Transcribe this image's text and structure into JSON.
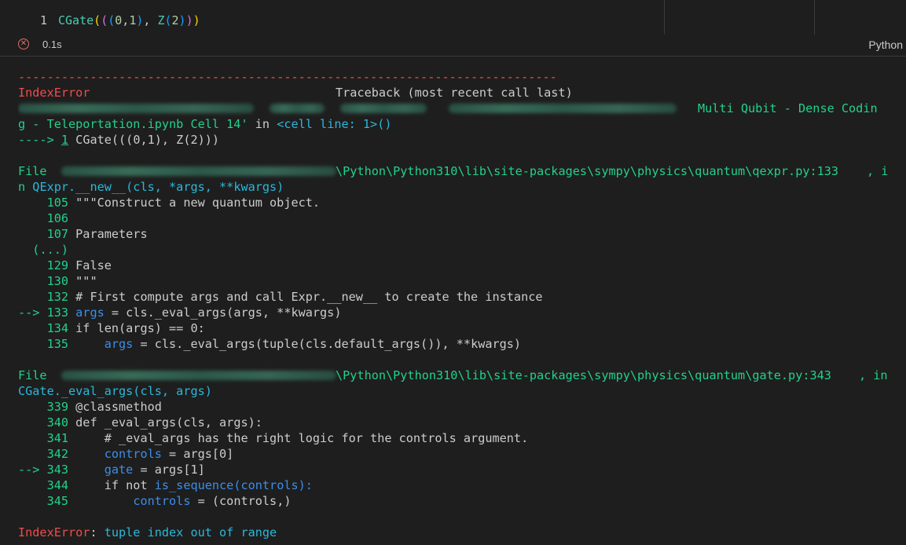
{
  "cell": {
    "line_number": "1",
    "code": {
      "fn": "CGate",
      "b1_open": "(",
      "b2_open": "(",
      "b3_open": "(",
      "n0": "0",
      "comma1": ",",
      "n1": "1",
      "b3_close": ")",
      "comma2": ", ",
      "z": "Z",
      "b3b_open": "(",
      "n2": "2",
      "b3b_close": ")",
      "b2_close": ")",
      "b1_close": ")"
    },
    "status_icon": "error-circle-icon",
    "exec_time": "0.1s",
    "language": "Python"
  },
  "output": {
    "separator": "---------------------------------------------------------------------------",
    "error_type": "IndexError",
    "traceback_header": "Traceback (most recent call last)",
    "cell_ref_tail": "Multi Qubit - Dense Codin",
    "cell_ref_line2": "g - Teleportation.ipynb Cell 14'",
    "in_word": " in ",
    "cell_line": "<cell line: 1>()",
    "arrow_prefix": "----> ",
    "arrow_lineno": "1",
    "arrow_code": " CGate(((0,1), Z(2)))",
    "frame1": {
      "file_label": "File ",
      "path": "\\Python\\Python310\\lib\\site-packages\\sympy\\physics\\quantum\\qexpr.py:133",
      "in_tail": ", i",
      "func_line_prefix": "n ",
      "func": "QExpr.__new__(cls, *args, **kwargs)",
      "lines": [
        {
          "prefix": "    ",
          "no": "105",
          "code": " \"\"\"Construct a new quantum object.",
          "hl": false
        },
        {
          "prefix": "    ",
          "no": "106",
          "code": "",
          "hl": false
        },
        {
          "prefix": "    ",
          "no": "107",
          "code": " Parameters",
          "hl": false
        },
        {
          "prefix": "  ",
          "no": "(...)",
          "code": "",
          "hl": false
        },
        {
          "prefix": "    ",
          "no": "129",
          "code": " False",
          "hl": false
        },
        {
          "prefix": "    ",
          "no": "130",
          "code": " \"\"\"",
          "hl": false
        },
        {
          "prefix": "    ",
          "no": "132",
          "code": " # First compute args and call Expr.__new__ to create the instance",
          "hl": false
        },
        {
          "prefix": "--> ",
          "no": "133",
          "code_hl": " args",
          "code": " = cls._eval_args(args, **kwargs)",
          "hl": true
        },
        {
          "prefix": "    ",
          "no": "134",
          "code": " if len(args) == 0:",
          "hl": false
        },
        {
          "prefix": "    ",
          "no": "135",
          "code_pre": "     ",
          "code_hl": "args",
          "code": " = cls._eval_args(tuple(cls.default_args()), **kwargs)",
          "hl": true
        }
      ]
    },
    "frame2": {
      "file_label": "File ",
      "path": "\\Python\\Python310\\lib\\site-packages\\sympy\\physics\\quantum\\gate.py:343",
      "in_tail": ", in",
      "func": "CGate._eval_args(cls, args)",
      "lines": [
        {
          "prefix": "    ",
          "no": "339",
          "code": " @classmethod"
        },
        {
          "prefix": "    ",
          "no": "340",
          "code": " def _eval_args(cls, args):"
        },
        {
          "prefix": "    ",
          "no": "341",
          "code": "     # _eval_args has the right logic for the controls argument."
        },
        {
          "prefix": "    ",
          "no": "342",
          "code_pre": "     ",
          "code_hl": "controls",
          "code": " = args[0]"
        },
        {
          "prefix": "--> ",
          "no": "343",
          "code_pre": "     ",
          "code_hl": "gate",
          "code": " = args[1]"
        },
        {
          "prefix": "    ",
          "no": "344",
          "code_pre": "     if not ",
          "code_hl": "is_sequence(controls):",
          "code": ""
        },
        {
          "prefix": "    ",
          "no": "345",
          "code_pre": "         ",
          "code_hl": "controls",
          "code": " = (controls,)"
        }
      ]
    },
    "final_error_type": "IndexError",
    "final_colon": ": ",
    "final_message": "tuple index out of range"
  }
}
